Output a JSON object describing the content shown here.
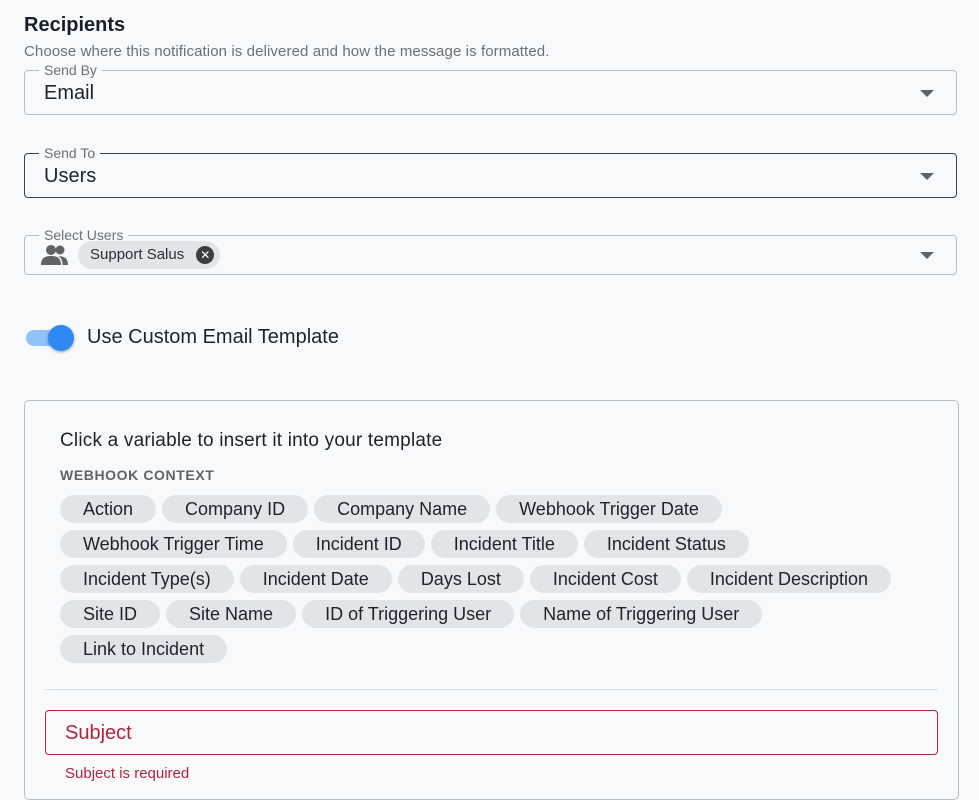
{
  "header": {
    "title": "Recipients",
    "subtitle": "Choose where this notification is delivered and how the message is formatted."
  },
  "send_by": {
    "label": "Send By",
    "value": "Email"
  },
  "send_to": {
    "label": "Send To",
    "value": "Users"
  },
  "select_users": {
    "label": "Select Users",
    "selected": [
      "Support Salus"
    ]
  },
  "toggle": {
    "label": "Use Custom Email Template",
    "on": true
  },
  "template_panel": {
    "heading": "Click a variable to insert it into your template",
    "section": "WEBHOOK CONTEXT",
    "variables": [
      [
        "Action",
        "Company ID",
        "Company Name",
        "Webhook Trigger Date"
      ],
      [
        "Webhook Trigger Time",
        "Incident ID",
        "Incident Title",
        "Incident Status"
      ],
      [
        "Incident Type(s)",
        "Incident Date",
        "Days Lost",
        "Incident Cost",
        "Incident Description"
      ],
      [
        "Site ID",
        "Site Name",
        "ID of Triggering User",
        "Name of Triggering User"
      ],
      [
        "Link to Incident"
      ]
    ]
  },
  "subject": {
    "label": "Subject",
    "error": "Subject is required"
  },
  "colors": {
    "accent": "#2f89f5",
    "error": "#b0243d",
    "chip_bg": "#e1e4e8"
  },
  "icons": {
    "people": "people-icon",
    "chip_remove": "close-circle-icon",
    "dropdown": "caret-down-icon"
  }
}
